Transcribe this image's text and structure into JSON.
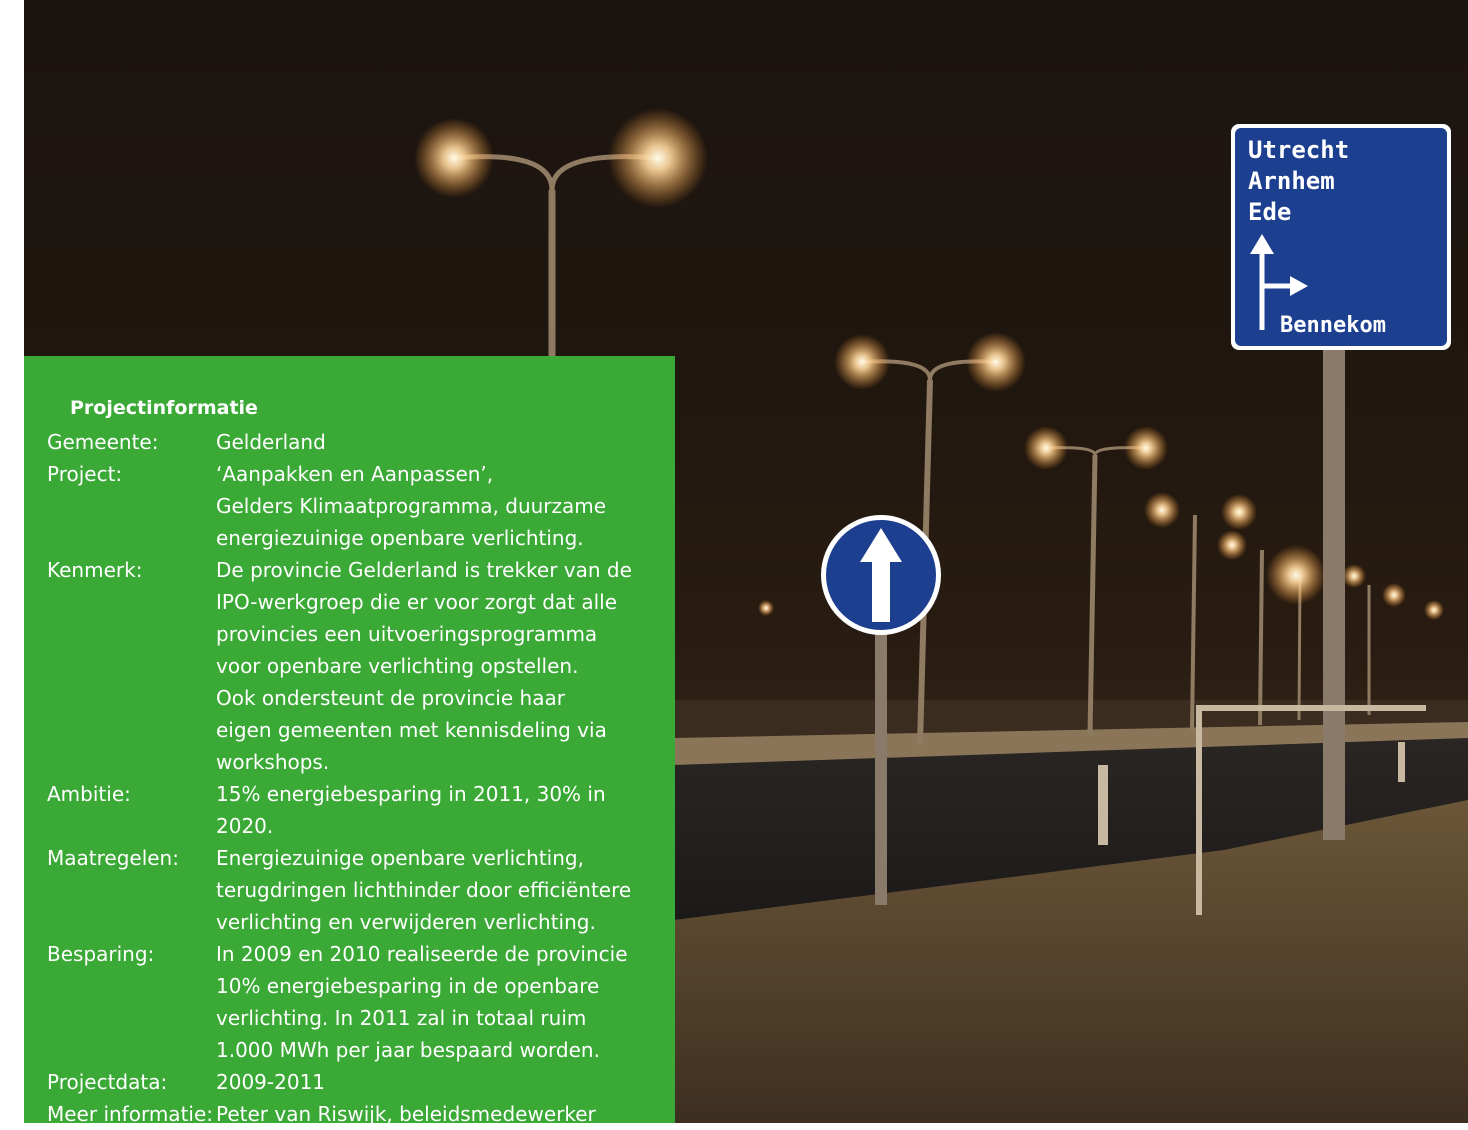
{
  "sign": {
    "lines": [
      "Utrecht",
      "Arnhem",
      "Ede"
    ],
    "exit": "Bennekom"
  },
  "panel": {
    "title": "Projectinformatie",
    "rows": [
      {
        "label": "Gemeente:",
        "lines": [
          "Gelderland"
        ]
      },
      {
        "label": "Project:",
        "lines": [
          "‘Aanpakken en Aanpassen’,",
          "Gelders Klimaatprogramma, duurzame",
          "energiezuinige openbare verlichting."
        ]
      },
      {
        "label": "Kenmerk:",
        "lines": [
          "De provincie Gelderland is trekker van de",
          "IPO-werkgroep die er voor zorgt dat alle",
          "provincies een uitvoeringsprogramma",
          "voor openbare verlichting opstellen.",
          "Ook ondersteunt de provincie haar",
          "eigen gemeenten met kennisdeling via",
          "workshops."
        ]
      },
      {
        "label": "Ambitie:",
        "lines": [
          "15% energiebesparing in 2011, 30% in",
          "2020."
        ]
      },
      {
        "label": "Maatregelen:",
        "lines": [
          "Energiezuinige openbare verlichting,",
          "terugdringen lichthinder door efficiëntere",
          "verlichting en verwijderen verlichting."
        ]
      },
      {
        "label": "Besparing:",
        "lines": [
          "In 2009 en 2010 realiseerde de provincie",
          "10% energiebesparing in de openbare",
          "verlichting. In 2011 zal in totaal ruim",
          "1.000 MWh per jaar bespaard worden."
        ]
      },
      {
        "label": "Projectdata:",
        "lines": [
          "2009-2011"
        ]
      },
      {
        "label": "Meer informatie:",
        "lines": [
          "Peter van Riswijk, beleidsmedewerker"
        ]
      }
    ]
  },
  "colors": {
    "panel_green": "#3aa935",
    "sign_blue": "#1d3f8f",
    "lamp_glow": "#ffd9a0"
  }
}
